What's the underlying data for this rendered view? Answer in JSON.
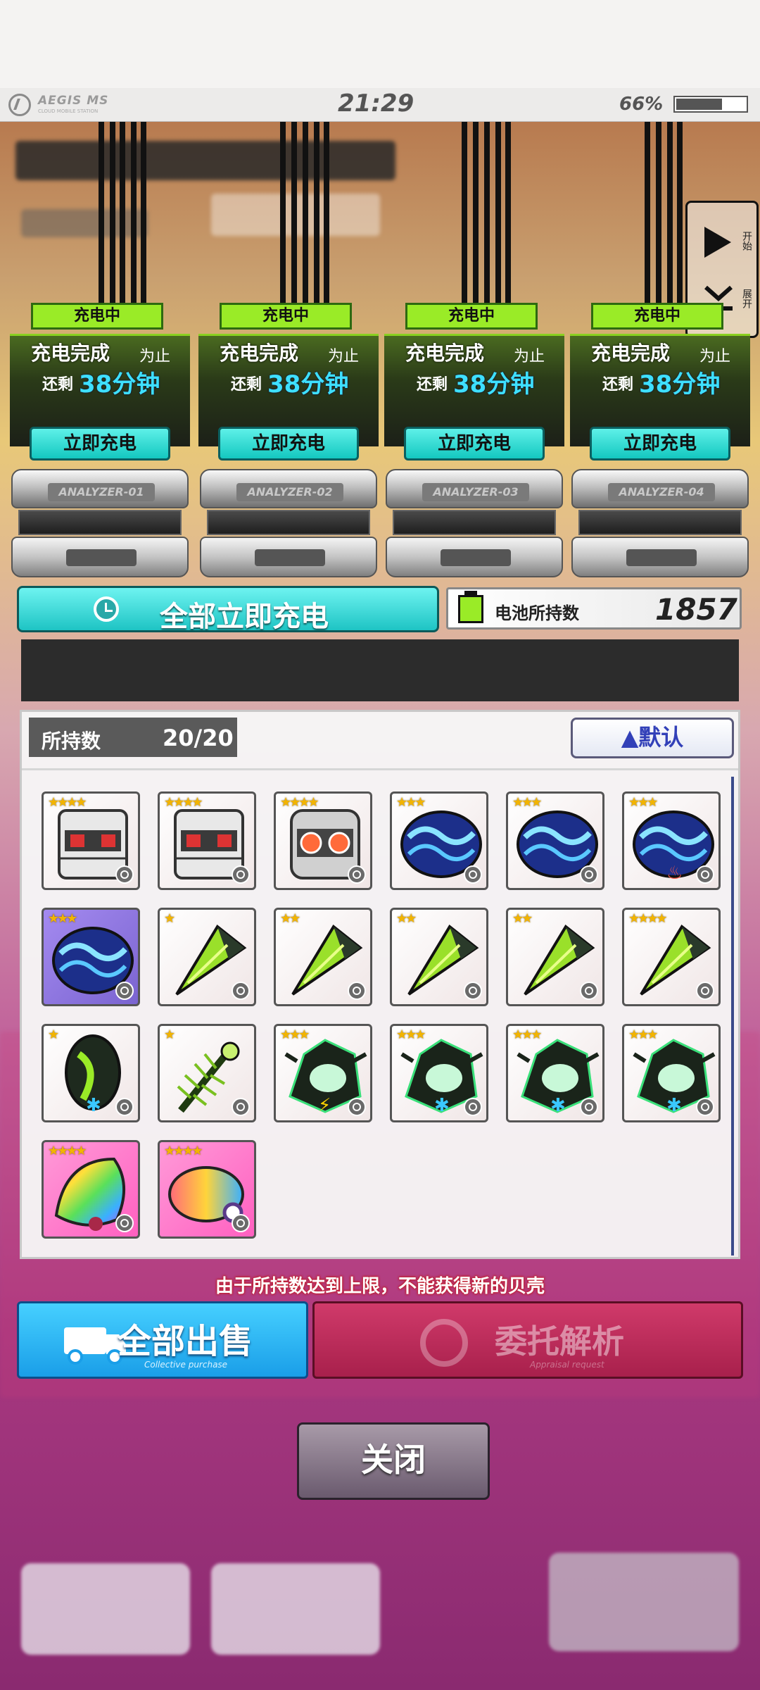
{
  "header": {
    "logo_text": "AEGIS MS",
    "logo_sub": "CLOUD MOBILE STATION",
    "time": "21:29",
    "battery_percent": "66%",
    "battery_level": 0.66
  },
  "side_panel": {
    "start_label": "开始",
    "expand_label": "展开"
  },
  "slots": [
    {
      "status": "充电中",
      "done_label": "充电完成",
      "done_suffix": "为止",
      "remain_label": "还剩",
      "remain_value": "38分钟",
      "charge_button": "立即充电",
      "analyzer": "ANALYZER-01"
    },
    {
      "status": "充电中",
      "done_label": "充电完成",
      "done_suffix": "为止",
      "remain_label": "还剩",
      "remain_value": "38分钟",
      "charge_button": "立即充电",
      "analyzer": "ANALYZER-02"
    },
    {
      "status": "充电中",
      "done_label": "充电完成",
      "done_suffix": "为止",
      "remain_label": "还剩",
      "remain_value": "38分钟",
      "charge_button": "立即充电",
      "analyzer": "ANALYZER-03"
    },
    {
      "status": "充电中",
      "done_label": "充电完成",
      "done_suffix": "为止",
      "remain_label": "还剩",
      "remain_value": "38分钟",
      "charge_button": "立即充电",
      "analyzer": "ANALYZER-04"
    }
  ],
  "charge_all": {
    "label": "全部立即充电",
    "icon": "clock-icon"
  },
  "battery_stock": {
    "label": "电池所持数",
    "value": "1857",
    "icon": "battery-icon"
  },
  "inventory": {
    "count_label": "所持数",
    "count_value": "20/20",
    "sort_label": "▲默认",
    "items": [
      {
        "stars": "★★★★",
        "kind": "armor-box",
        "bg": "white"
      },
      {
        "stars": "★★★★",
        "kind": "armor-box",
        "bg": "white"
      },
      {
        "stars": "★★★★",
        "kind": "armor-core",
        "bg": "white"
      },
      {
        "stars": "★★★",
        "kind": "blue-clam",
        "bg": "white"
      },
      {
        "stars": "★★★",
        "kind": "blue-clam",
        "bg": "white"
      },
      {
        "stars": "★★★",
        "kind": "blue-clam",
        "bg": "white",
        "badge": "flame"
      },
      {
        "stars": "★★★",
        "kind": "blue-clam",
        "bg": "purple"
      },
      {
        "stars": "★",
        "kind": "green-conch",
        "bg": "white"
      },
      {
        "stars": "★★",
        "kind": "green-conch",
        "bg": "white"
      },
      {
        "stars": "★★",
        "kind": "green-conch",
        "bg": "white"
      },
      {
        "stars": "★★",
        "kind": "green-conch",
        "bg": "white"
      },
      {
        "stars": "★★★★",
        "kind": "green-conch",
        "bg": "white"
      },
      {
        "stars": "★",
        "kind": "green-cone",
        "bg": "white",
        "badge": "snow"
      },
      {
        "stars": "★",
        "kind": "spiky-shell",
        "bg": "white"
      },
      {
        "stars": "★★★",
        "kind": "dark-murex",
        "bg": "white",
        "badge": "bolt"
      },
      {
        "stars": "★★★",
        "kind": "dark-murex",
        "bg": "white",
        "badge": "snow"
      },
      {
        "stars": "★★★",
        "kind": "dark-murex",
        "bg": "white",
        "badge": "snow"
      },
      {
        "stars": "★★★",
        "kind": "dark-murex",
        "bg": "white",
        "badge": "snow"
      },
      {
        "stars": "★★★★",
        "kind": "rainbow-shell",
        "bg": "pink"
      },
      {
        "stars": "★★★★",
        "kind": "rainbow-cowrie",
        "bg": "pink"
      }
    ]
  },
  "limit_message": "由于所持数达到上限，不能获得新的贝壳",
  "sell_all": {
    "label": "全部出售",
    "sub": "Collective purchase",
    "icon": "truck-icon"
  },
  "appraise": {
    "label": "委托解析",
    "sub": "Appraisal request",
    "icon": "ring-icon"
  },
  "close_label": "关闭",
  "colors": {
    "status_green": "#9aeb27",
    "teal_button": "#1ec4c4",
    "remain_cyan": "#3ee0ff",
    "sell_blue": "#1a9ee8",
    "appraise_red": "#a8204c",
    "star_gold": "#f2b400"
  }
}
